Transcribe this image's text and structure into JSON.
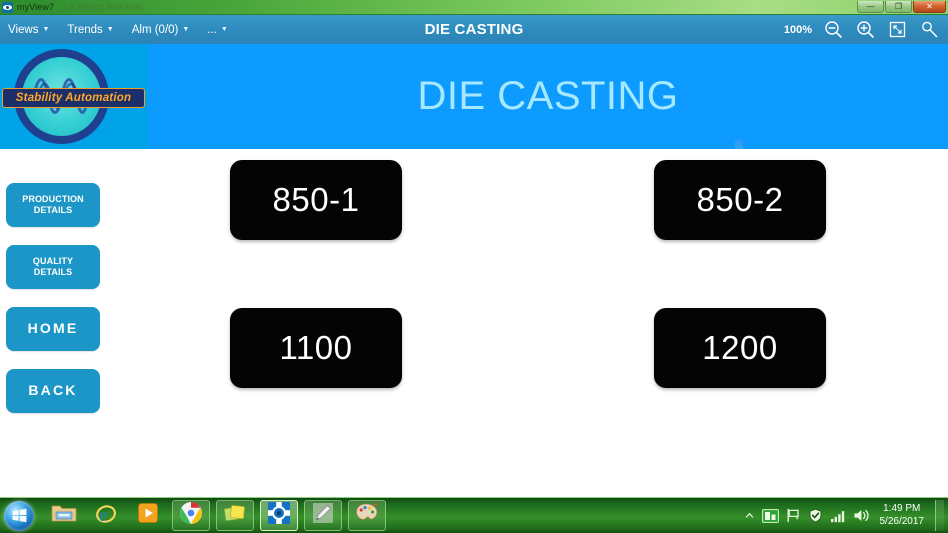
{
  "window": {
    "app_title": "myView7",
    "ghost_text": "n a      search  theit  bins",
    "minimize_label": "—",
    "maximize_label": "❐",
    "close_label": "✕"
  },
  "menubar": {
    "title": "DIE CASTING",
    "items": [
      {
        "label": "Views",
        "caret": "▼"
      },
      {
        "label": "Trends",
        "caret": "▼"
      },
      {
        "label": "Alm (0/0)",
        "caret": "▼"
      },
      {
        "label": "...",
        "caret": "▼"
      }
    ],
    "zoom_level": "100%",
    "icons": [
      {
        "name": "zoom-out-icon"
      },
      {
        "name": "zoom-in-icon"
      },
      {
        "name": "fit-to-screen-icon"
      },
      {
        "name": "search-icon"
      }
    ]
  },
  "logo": {
    "company_name": "Stability Automation",
    "banner_bg": "#1b2f6b",
    "banner_border": "#f59b2a",
    "text_color": "#f7a93c",
    "ring_color": "#1f3f8f",
    "disc_color": "#35cfd4",
    "panel_bg": "#00a2e8"
  },
  "header": {
    "title": "DIE CASTING",
    "bg": "#0d9bff",
    "text_color": "#a6e9ff"
  },
  "sidebar": {
    "buttons": [
      {
        "line1": "PRODUCTION",
        "line2": "DETAILS",
        "style": "two-line",
        "name": "production-details"
      },
      {
        "line1": "QUALITY",
        "line2": "DETAILS",
        "style": "two-line",
        "name": "quality-details"
      },
      {
        "line1": "HOME",
        "line2": "",
        "style": "one-line",
        "name": "home"
      },
      {
        "line1": "BACK",
        "line2": "",
        "style": "one-line",
        "name": "back"
      }
    ],
    "bg": "#1b96c6"
  },
  "machine_tiles": {
    "bg": "#040404",
    "text_color": "#ffffff",
    "rows": [
      [
        {
          "label": "850-1"
        },
        {
          "label": "850-2"
        }
      ],
      [
        {
          "label": "1100"
        },
        {
          "label": "1200"
        }
      ]
    ]
  },
  "taskbar": {
    "start_label": "Start",
    "items": [
      {
        "name": "file-explorer-icon",
        "active": false,
        "framed": false
      },
      {
        "name": "internet-explorer-icon",
        "active": false,
        "framed": false
      },
      {
        "name": "media-player-icon",
        "active": false,
        "framed": false
      },
      {
        "name": "chrome-icon",
        "active": false,
        "framed": true
      },
      {
        "name": "sticky-notes-icon",
        "active": false,
        "framed": true
      },
      {
        "name": "myview-eye-icon",
        "active": true,
        "framed": true
      },
      {
        "name": "pen-editor-icon",
        "active": false,
        "framed": true
      },
      {
        "name": "paint-icon",
        "active": false,
        "framed": true
      }
    ],
    "tray": [
      {
        "name": "show-hidden-icons-icon"
      },
      {
        "name": "network-monitor-icon"
      },
      {
        "name": "action-center-flag-icon"
      },
      {
        "name": "antivirus-shield-icon"
      },
      {
        "name": "signal-bars-icon"
      },
      {
        "name": "volume-speaker-icon"
      }
    ],
    "clock_time": "1:49 PM",
    "clock_date": "5/26/2017"
  }
}
